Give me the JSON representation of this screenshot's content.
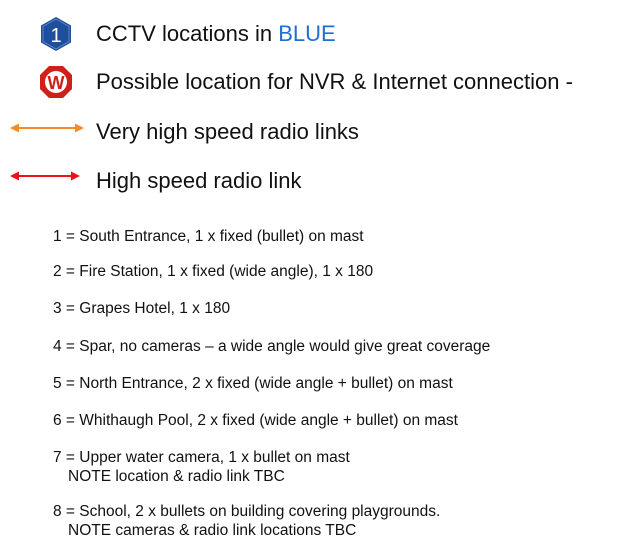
{
  "legend": {
    "cctv": {
      "icon_number": "1",
      "label_prefix": "CCTV locations in ",
      "label_highlight": "BLUE",
      "icon": "blue-numbered-hexagon-icon",
      "color": "#1f4e9c"
    },
    "nvr": {
      "icon_letter": "W",
      "label": "Possible location for NVR & Internet connection -",
      "icon": "red-w-badge-icon",
      "color": "#d0201a"
    },
    "very_high": {
      "label": "Very high speed radio links",
      "icon": "orange-double-arrow-icon",
      "color": "#f28c28"
    },
    "high": {
      "label": "High speed radio link",
      "icon": "red-double-arrow-icon",
      "color": "#e8141a"
    }
  },
  "locations": [
    {
      "line1": "1 = South Entrance, 1 x fixed (bullet) on mast"
    },
    {
      "line1": "2 = Fire Station, 1 x fixed (wide angle), 1 x 180"
    },
    {
      "line1": "3 = Grapes Hotel, 1 x 180"
    },
    {
      "line1": "4 = Spar, no cameras – a wide angle would give great coverage"
    },
    {
      "line1": "5 = North Entrance, 2 x fixed (wide angle + bullet) on mast"
    },
    {
      "line1": "6 = Whithaugh Pool, 2 x fixed (wide angle + bullet) on mast"
    },
    {
      "line1": "7 = Upper water camera, 1 x bullet on mast",
      "line2": "NOTE location & radio link TBC"
    },
    {
      "line1": "8 = School, 2 x bullets on building covering playgrounds.",
      "line2": "NOTE cameras & radio link locations TBC"
    }
  ]
}
